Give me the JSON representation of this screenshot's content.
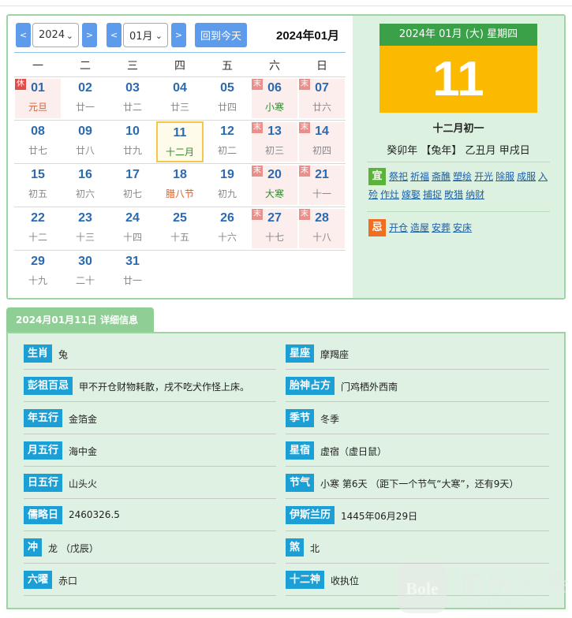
{
  "calendar": {
    "prev_year": "<",
    "year_value": "2024",
    "next_year": ">",
    "prev_month": "<",
    "month_value": "01月",
    "next_month": ">",
    "today_button": "回到今天",
    "title": "2024年01月",
    "weekdays": [
      "一",
      "二",
      "三",
      "四",
      "五",
      "六",
      "日"
    ],
    "weeks": [
      [
        {
          "day": "01",
          "lunar": "元旦",
          "tag": "休",
          "tagtype": "rest",
          "style": "fest",
          "weekend": true
        },
        {
          "day": "02",
          "lunar": "廿一"
        },
        {
          "day": "03",
          "lunar": "廿二"
        },
        {
          "day": "04",
          "lunar": "廿三"
        },
        {
          "day": "05",
          "lunar": "廿四"
        },
        {
          "day": "06",
          "lunar": "小寒",
          "tag": "末",
          "tagtype": "wkd",
          "style": "term",
          "weekend": true
        },
        {
          "day": "07",
          "lunar": "廿六",
          "tag": "末",
          "tagtype": "wkd",
          "weekend": true
        }
      ],
      [
        {
          "day": "08",
          "lunar": "廿七"
        },
        {
          "day": "09",
          "lunar": "廿八"
        },
        {
          "day": "10",
          "lunar": "廿九"
        },
        {
          "day": "11",
          "lunar": "十二月",
          "today": true
        },
        {
          "day": "12",
          "lunar": "初二"
        },
        {
          "day": "13",
          "lunar": "初三",
          "tag": "末",
          "tagtype": "wkd",
          "weekend": true
        },
        {
          "day": "14",
          "lunar": "初四",
          "tag": "末",
          "tagtype": "wkd",
          "weekend": true
        }
      ],
      [
        {
          "day": "15",
          "lunar": "初五"
        },
        {
          "day": "16",
          "lunar": "初六"
        },
        {
          "day": "17",
          "lunar": "初七"
        },
        {
          "day": "18",
          "lunar": "腊八节",
          "style": "fest"
        },
        {
          "day": "19",
          "lunar": "初九"
        },
        {
          "day": "20",
          "lunar": "大寒",
          "tag": "末",
          "tagtype": "wkd",
          "style": "term",
          "weekend": true
        },
        {
          "day": "21",
          "lunar": "十一",
          "tag": "末",
          "tagtype": "wkd",
          "weekend": true
        }
      ],
      [
        {
          "day": "22",
          "lunar": "十二"
        },
        {
          "day": "23",
          "lunar": "十三"
        },
        {
          "day": "24",
          "lunar": "十四"
        },
        {
          "day": "25",
          "lunar": "十五"
        },
        {
          "day": "26",
          "lunar": "十六"
        },
        {
          "day": "27",
          "lunar": "十七",
          "tag": "末",
          "tagtype": "wkd",
          "weekend": true
        },
        {
          "day": "28",
          "lunar": "十八",
          "tag": "末",
          "tagtype": "wkd",
          "weekend": true
        }
      ],
      [
        {
          "day": "29",
          "lunar": "十九"
        },
        {
          "day": "30",
          "lunar": "二十"
        },
        {
          "day": "31",
          "lunar": "廿一"
        }
      ]
    ]
  },
  "today_card": {
    "header": "2024年 01月 (大) 星期四",
    "big_day": "11",
    "lunar_date": "十二月初一",
    "ganzhi": "癸卯年 【兔年】 乙丑月 甲戌日",
    "yi_label": "宜",
    "yi_items": [
      "祭祀",
      "祈福",
      "斋醮",
      "塑绘",
      "开光",
      "除服",
      "成服",
      "入殓",
      "作灶",
      "嫁娶",
      "捕捉",
      "畋猎",
      "纳财"
    ],
    "ji_label": "忌",
    "ji_items": [
      "开仓",
      "造屋",
      "安葬",
      "安床"
    ]
  },
  "details": {
    "tab_title": "2024月01月11日 详细信息",
    "left": [
      {
        "label": "生肖",
        "value": "兔"
      },
      {
        "label": "彭祖百忌",
        "value": "甲不开仓财物耗散，戌不吃犬作怪上床。"
      },
      {
        "label": "年五行",
        "value": "金箔金"
      },
      {
        "label": "月五行",
        "value": "海中金"
      },
      {
        "label": "日五行",
        "value": "山头火"
      },
      {
        "label": "儒略日",
        "value": "2460326.5"
      },
      {
        "label": "冲",
        "value": "龙 （戊辰）"
      },
      {
        "label": "六曜",
        "value": "赤口"
      }
    ],
    "right": [
      {
        "label": "星座",
        "value": "摩羯座"
      },
      {
        "label": "胎神占方",
        "value": "门鸡栖外西南"
      },
      {
        "label": "季节",
        "value": "冬季"
      },
      {
        "label": "星宿",
        "value": "虚宿（虚日鼠）"
      },
      {
        "label": "节气",
        "value": "小寒 第6天 （距下一个节气“大寒”，还有9天）"
      },
      {
        "label": "伊斯兰历",
        "value": "1445年06月29日"
      },
      {
        "label": "煞",
        "value": "北"
      },
      {
        "label": "十二神",
        "value": "收执位"
      }
    ]
  },
  "watermark": {
    "logo_text": "Bole",
    "cn_text": "伯乐头条",
    "en_text": "bole9.com"
  },
  "colors": {
    "accent_blue": "#5d9cec",
    "panel_green": "#dcf1e0",
    "header_green": "#3ba149",
    "today_yellow": "#fbb900",
    "label_blue": "#1c9fd4",
    "yi_green": "#5bb33b",
    "ji_orange": "#f06d21"
  }
}
